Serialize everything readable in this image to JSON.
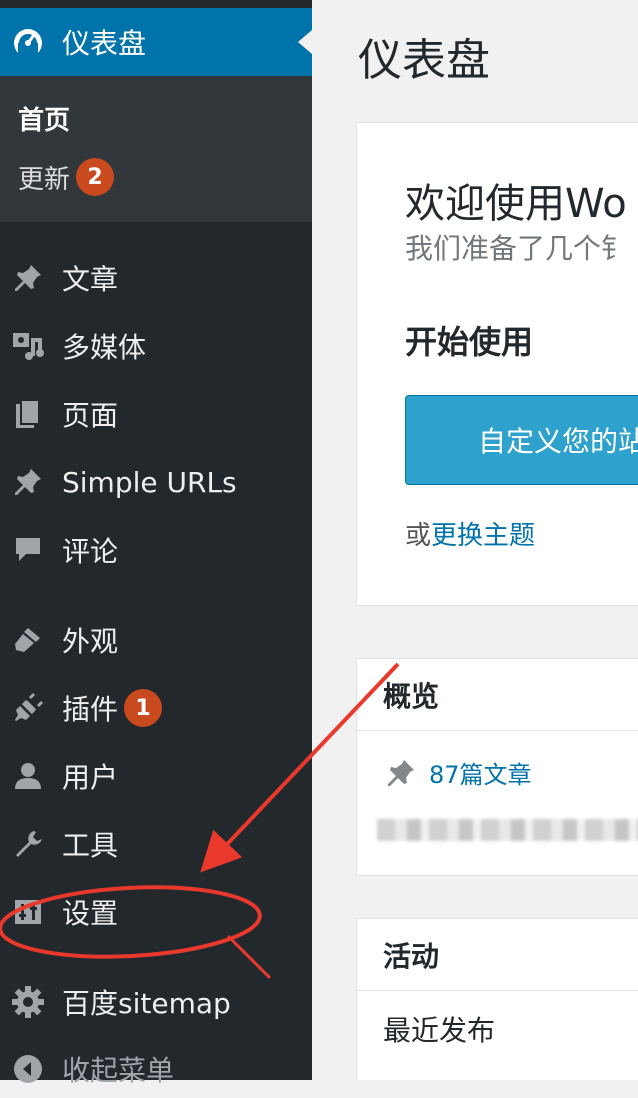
{
  "sidebar": {
    "active": {
      "label": "仪表盘",
      "icon": "dashboard-icon"
    },
    "submenu": {
      "home": "首页",
      "updates": {
        "label": "更新",
        "count": "2"
      }
    },
    "items": [
      {
        "label": "文章",
        "icon": "pushpin-icon"
      },
      {
        "label": "多媒体",
        "icon": "media-icon"
      },
      {
        "label": "页面",
        "icon": "pages-icon"
      },
      {
        "label": "Simple URLs",
        "icon": "pushpin-icon"
      },
      {
        "label": "评论",
        "icon": "comment-icon"
      },
      {
        "label": "外观",
        "icon": "paintbrush-icon"
      },
      {
        "label": "插件",
        "icon": "plugin-icon",
        "badge": "1"
      },
      {
        "label": "用户",
        "icon": "user-icon"
      },
      {
        "label": "工具",
        "icon": "wrench-icon"
      },
      {
        "label": "设置",
        "icon": "settings-icon"
      },
      {
        "label": "百度sitemap",
        "icon": "gear-icon"
      },
      {
        "label": "收起菜单",
        "icon": "collapse-icon"
      }
    ]
  },
  "main": {
    "title": "仪表盘",
    "welcome": {
      "title": "欢迎使用Wo",
      "subtitle": "我们准备了几个钅",
      "get_started": "开始使用",
      "button": "自定义您的站",
      "or_prefix": "或",
      "or_link": "更换主题"
    },
    "glance": {
      "title": "概览",
      "posts": "87篇文章"
    },
    "activity": {
      "title": "活动",
      "recent": "最近发布"
    }
  },
  "colors": {
    "sidebar_bg": "#23282d",
    "active_bg": "#0073aa",
    "badge": "#ca4a1f",
    "button": "#2ea2cc",
    "annotation": "#e8392c"
  }
}
